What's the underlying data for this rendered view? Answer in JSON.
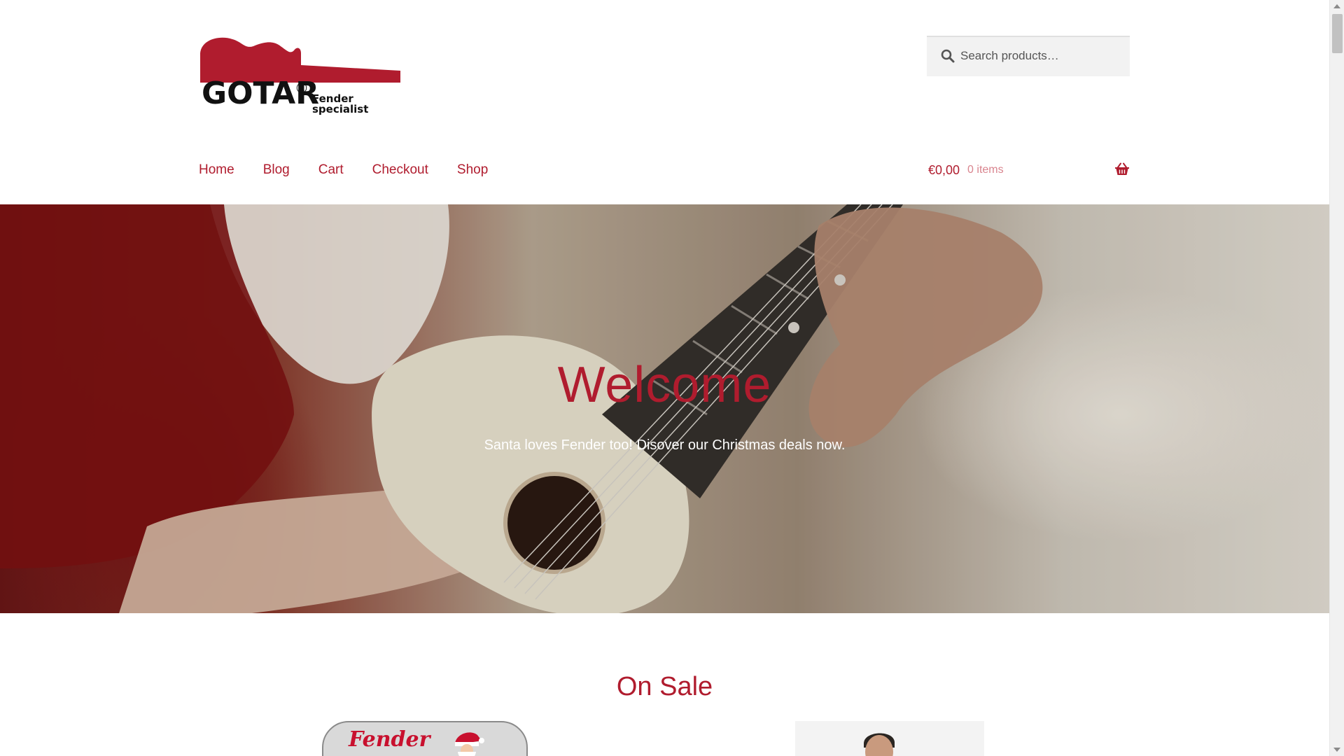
{
  "brand": {
    "logo_word": "GOTAR",
    "logo_reg": "®",
    "logo_tagline": "Fender specialist",
    "accent_color": "#b01c2e"
  },
  "search": {
    "placeholder": "Search products…",
    "icon": "search-icon"
  },
  "nav": {
    "items": [
      {
        "label": "Home"
      },
      {
        "label": "Blog"
      },
      {
        "label": "Cart"
      },
      {
        "label": "Checkout"
      },
      {
        "label": "Shop"
      }
    ]
  },
  "cart": {
    "amount": "€0,00",
    "count": "0 items",
    "icon": "basket-icon"
  },
  "hero": {
    "title": "Welcome",
    "subtitle": "Santa loves Fender too! Disover our Christmas deals now."
  },
  "on_sale": {
    "title": "On Sale",
    "product_1_brand": "Fender"
  },
  "colors": {
    "link": "#b01c2e",
    "muted_link": "#d9848e",
    "hero_text": "#ffffff"
  }
}
